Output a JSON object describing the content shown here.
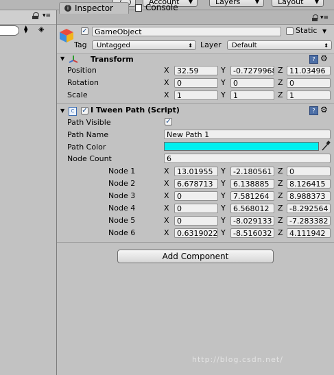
{
  "toolbar": {
    "account_label": "Account",
    "layers_label": "Layers",
    "layout_label": "Layout"
  },
  "tabs": {
    "inspector_label": "Inspector",
    "console_label": "Console"
  },
  "gameobject": {
    "name": "GameObject",
    "active": true,
    "static_label": "Static",
    "static_checked": false,
    "tag_label": "Tag",
    "tag_value": "Untagged",
    "layer_label": "Layer",
    "layer_value": "Default"
  },
  "transform": {
    "title": "Transform",
    "rows": [
      {
        "label": "Position",
        "x": "32.59",
        "y": "-0.7279968",
        "z": "11.03496"
      },
      {
        "label": "Rotation",
        "x": "0",
        "y": "0",
        "z": "0"
      },
      {
        "label": "Scale",
        "x": "1",
        "y": "1",
        "z": "1"
      }
    ]
  },
  "itween": {
    "title": "I Tween Path (Script)",
    "enabled": true,
    "path_visible_label": "Path Visible",
    "path_visible": true,
    "path_name_label": "Path Name",
    "path_name": "New Path 1",
    "path_color_label": "Path Color",
    "path_color": "#00f0f0",
    "node_count_label": "Node Count",
    "node_count": "6",
    "nodes": [
      {
        "label": "Node 1",
        "x": "13.01955",
        "y": "-2.180561",
        "z": "0"
      },
      {
        "label": "Node 2",
        "x": "6.678713",
        "y": "6.138885",
        "z": "8.126415"
      },
      {
        "label": "Node 3",
        "x": "0",
        "y": "7.581264",
        "z": "8.988373"
      },
      {
        "label": "Node 4",
        "x": "0",
        "y": "6.568012",
        "z": "-8.292564"
      },
      {
        "label": "Node 5",
        "x": "0",
        "y": "-8.029133",
        "z": "-7.283382"
      },
      {
        "label": "Node 6",
        "x": "0.6319022",
        "y": "-8.516032",
        "z": "4.111942"
      }
    ]
  },
  "axis": {
    "x": "X",
    "y": "Y",
    "z": "Z"
  },
  "add_component_label": "Add Component",
  "watermark": "http://blog.csdn.net/"
}
